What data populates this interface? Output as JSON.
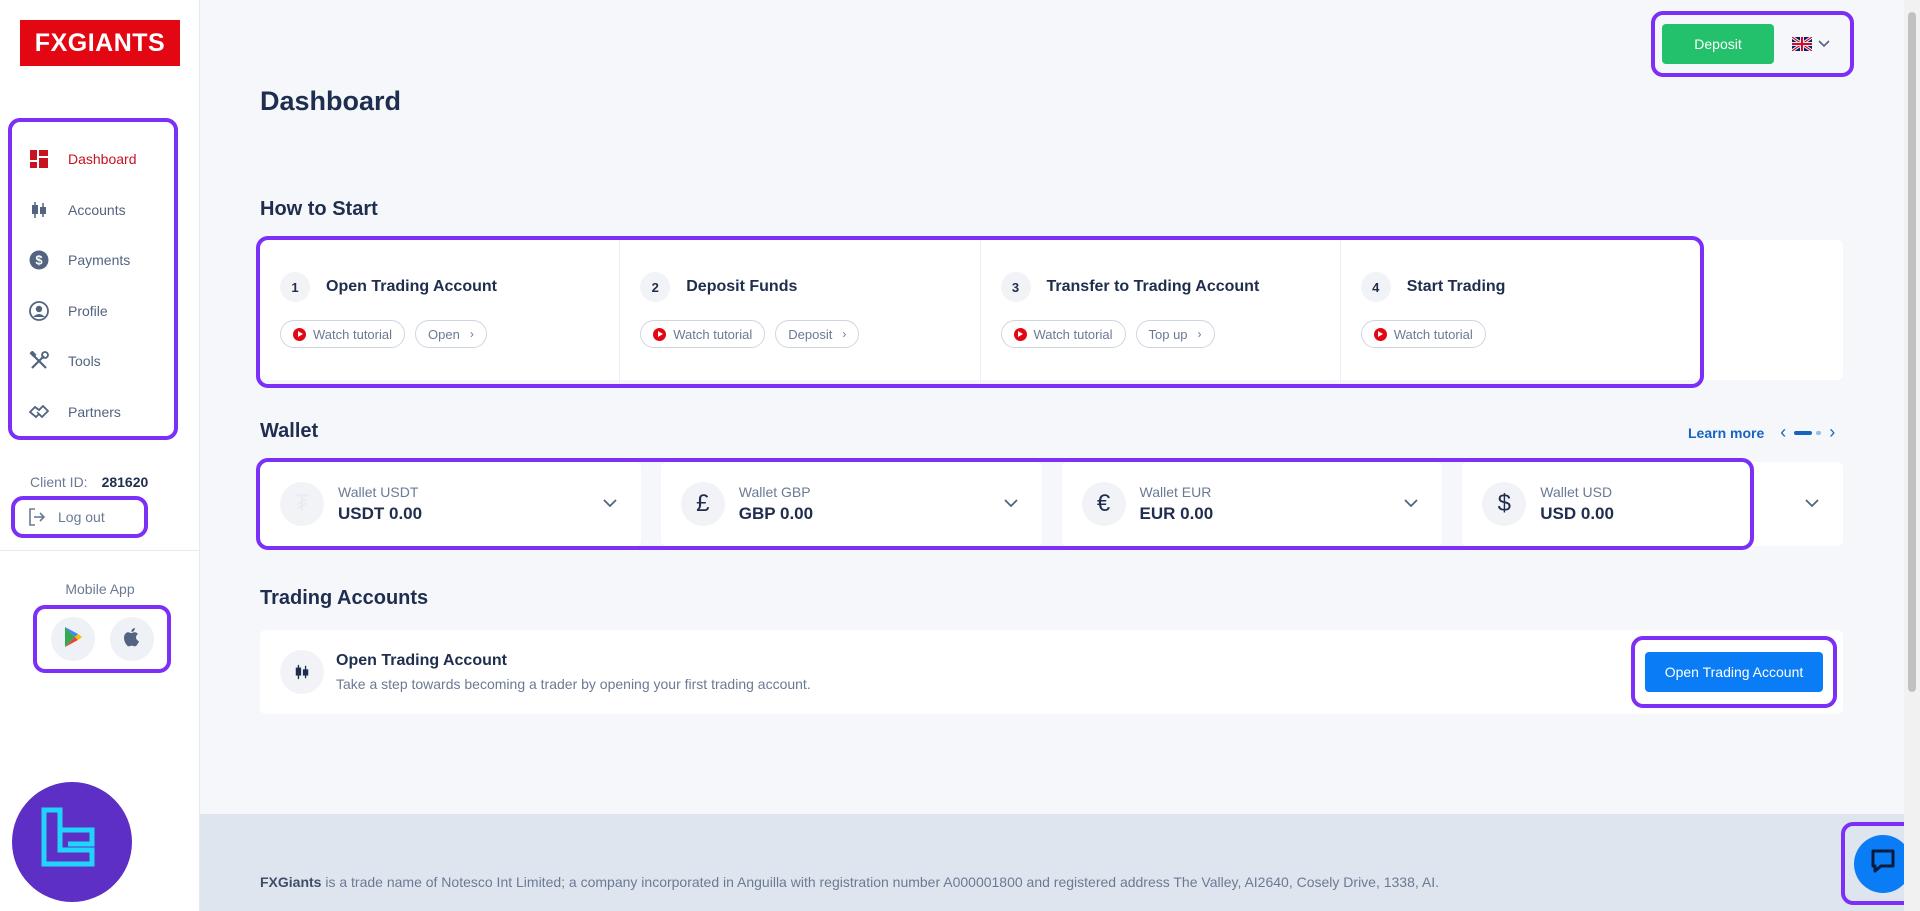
{
  "brand": {
    "logo_text": "FXGIANTS"
  },
  "sidebar": {
    "items": [
      {
        "label": "Dashboard",
        "icon": "dashboard-icon",
        "active": true
      },
      {
        "label": "Accounts",
        "icon": "candlestick-icon"
      },
      {
        "label": "Payments",
        "icon": "dollar-circle-icon"
      },
      {
        "label": "Profile",
        "icon": "user-circle-icon"
      },
      {
        "label": "Tools",
        "icon": "tools-icon"
      },
      {
        "label": "Partners",
        "icon": "handshake-icon"
      }
    ],
    "client_label": "Client ID:",
    "client_id": "281620",
    "logout_label": "Log out",
    "mobile_app_label": "Mobile App",
    "stores": [
      "google-play-icon",
      "apple-icon"
    ]
  },
  "header": {
    "deposit_label": "Deposit",
    "language_icon": "uk-flag-icon"
  },
  "page_title": "Dashboard",
  "how_to_start": {
    "title": "How to Start",
    "steps": [
      {
        "num": "1",
        "title": "Open Trading Account",
        "tutorial": "Watch tutorial",
        "action": "Open"
      },
      {
        "num": "2",
        "title": "Deposit Funds",
        "tutorial": "Watch tutorial",
        "action": "Deposit"
      },
      {
        "num": "3",
        "title": "Transfer to Trading Account",
        "tutorial": "Watch tutorial",
        "action": "Top up"
      },
      {
        "num": "4",
        "title": "Start Trading",
        "tutorial": "Watch tutorial"
      }
    ]
  },
  "wallet": {
    "title": "Wallet",
    "learn_more": "Learn more",
    "wallets": [
      {
        "name": "Wallet USDT",
        "value": "USDT 0.00",
        "icon": "tether-icon",
        "symbol": "₮"
      },
      {
        "name": "Wallet GBP",
        "value": "GBP 0.00",
        "icon": "pound-icon",
        "symbol": "£"
      },
      {
        "name": "Wallet EUR",
        "value": "EUR 0.00",
        "icon": "euro-icon",
        "symbol": "€"
      },
      {
        "name": "Wallet USD",
        "value": "USD 0.00",
        "icon": "dollar-icon",
        "symbol": "$"
      }
    ]
  },
  "trading_accounts": {
    "title": "Trading Accounts",
    "card_title": "Open Trading Account",
    "card_subtitle": "Take a step towards becoming a trader by opening your first trading account.",
    "button_label": "Open Trading Account"
  },
  "footer": {
    "brand": "FXGiants",
    "text": " is a trade name of Notesco Int Limited; a company incorporated in Anguilla with registration number A000001800 and registered address The Valley, AI2640, Cosely Drive, 1338, AI."
  },
  "colors": {
    "brand_red": "#e30613",
    "deposit_green": "#23c16b",
    "primary_blue": "#0a7cf5",
    "highlight": "#7b2ff7"
  }
}
